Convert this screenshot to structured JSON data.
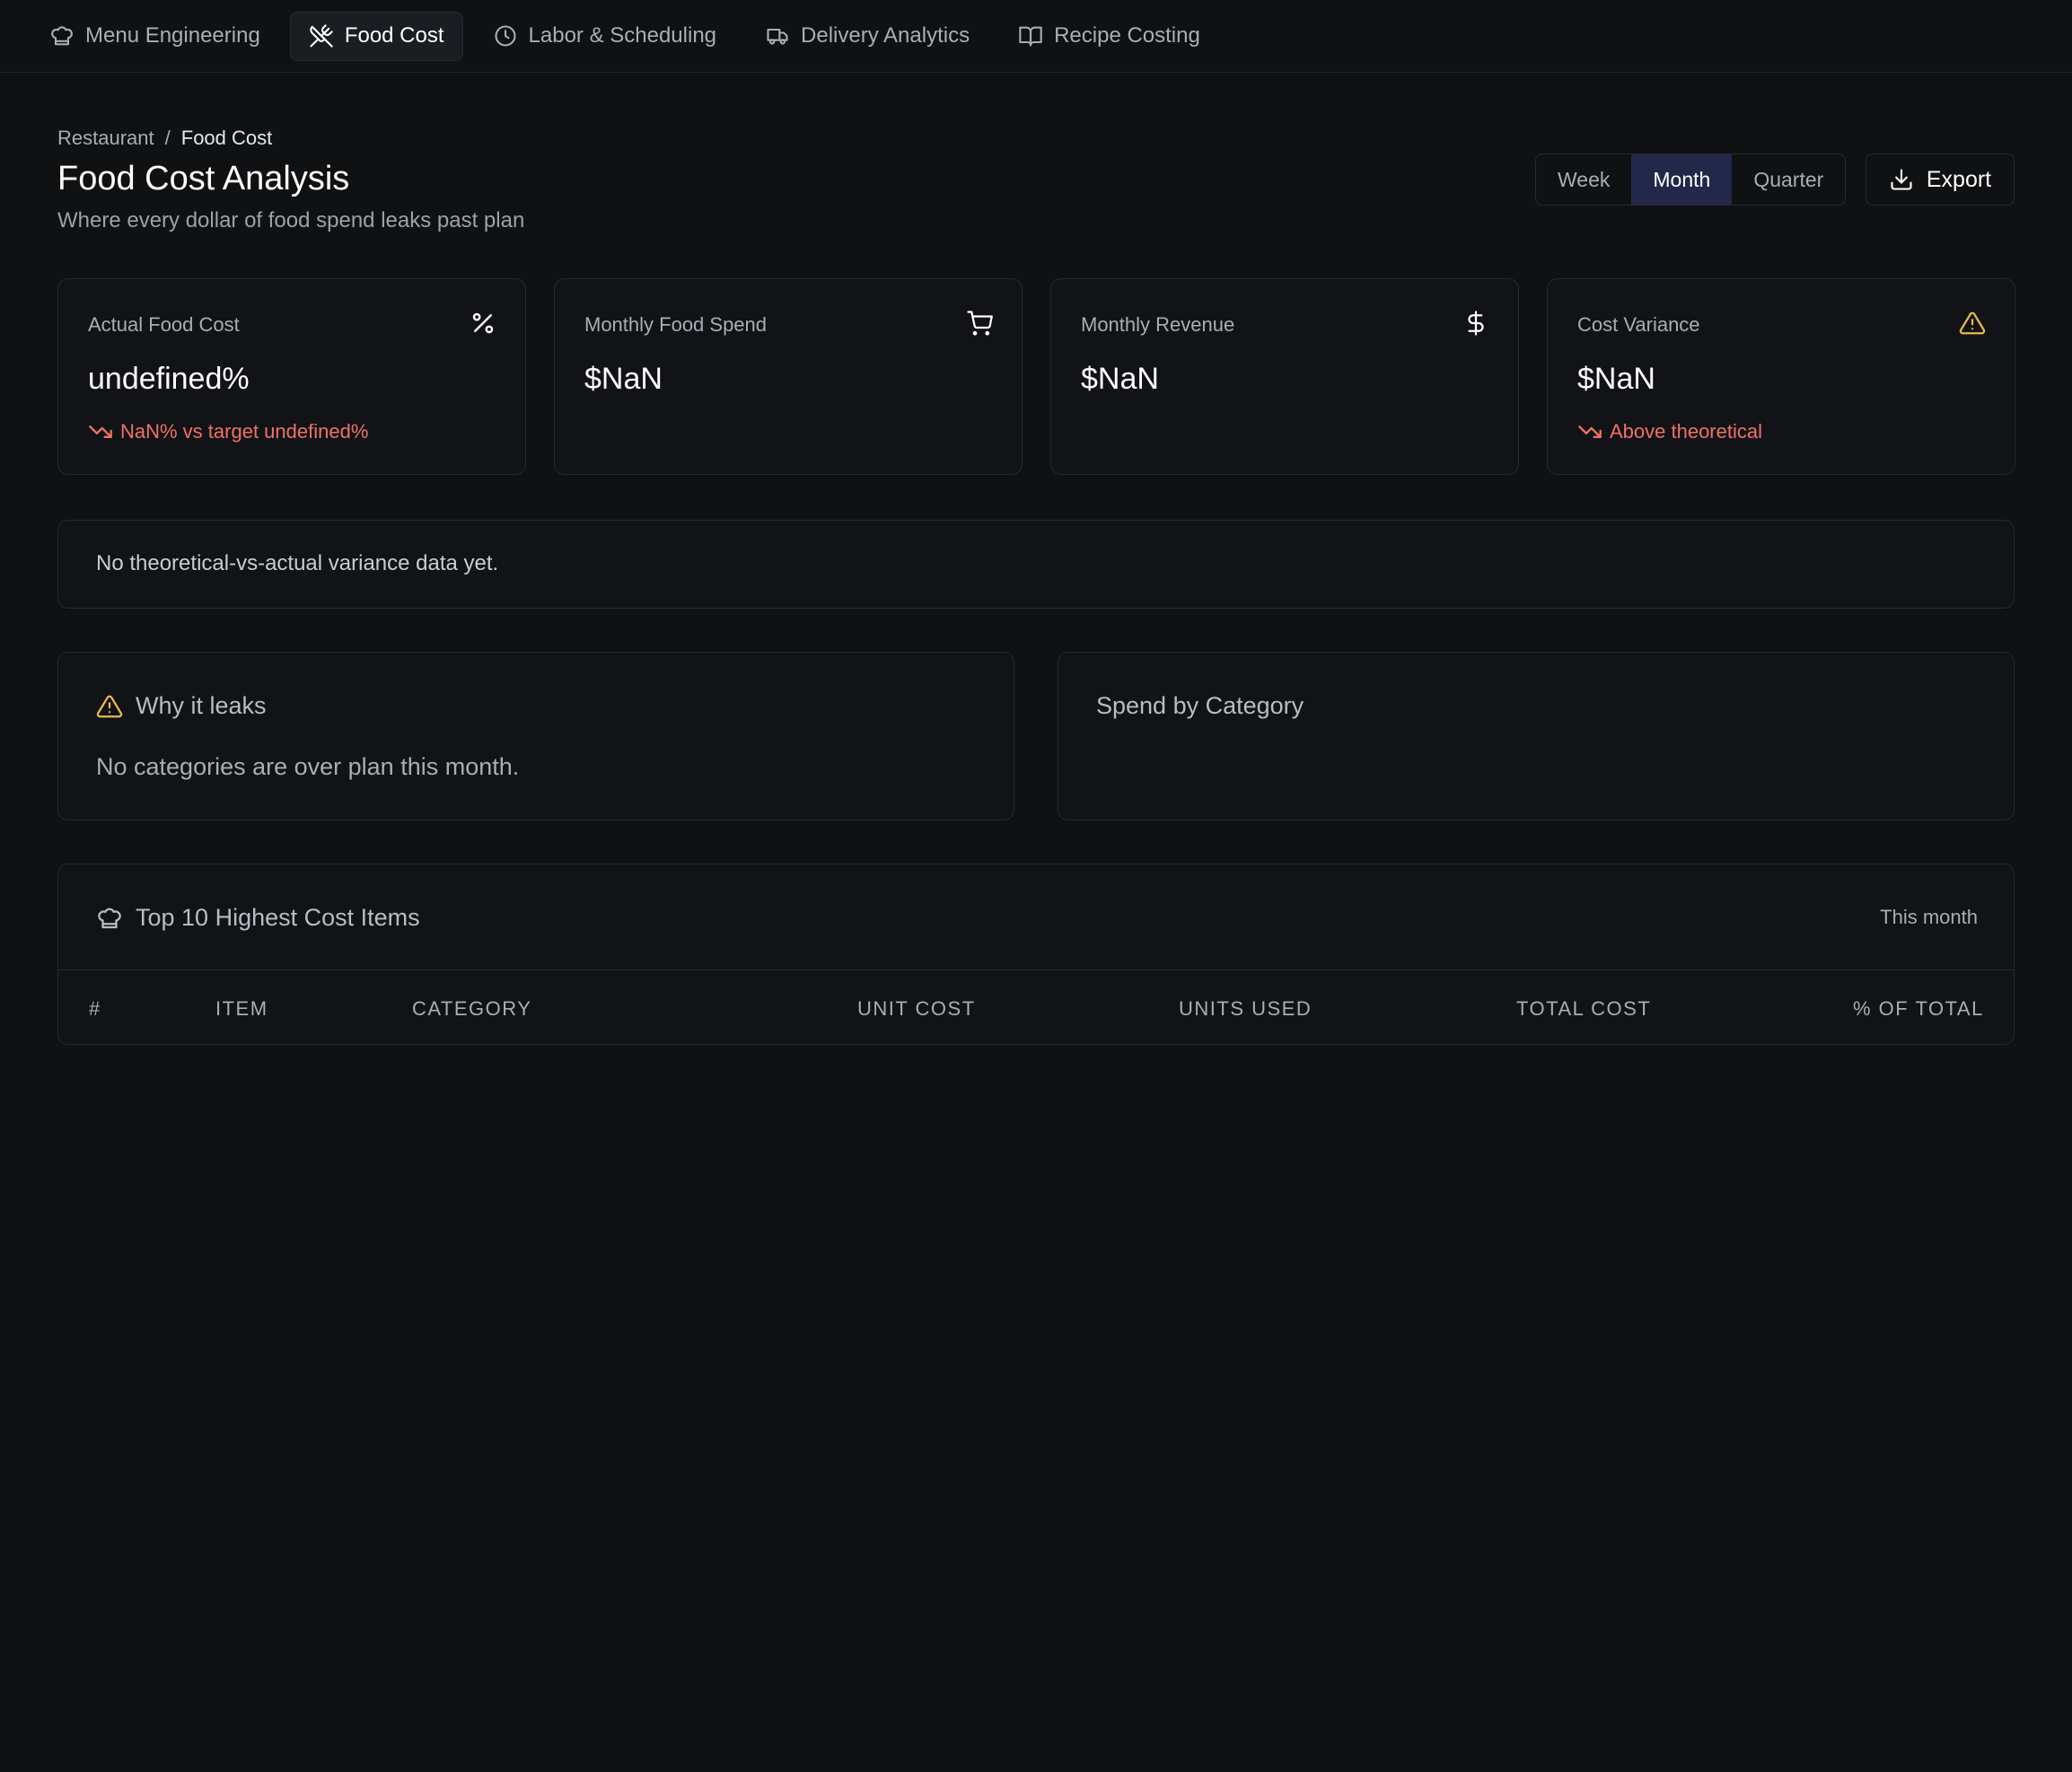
{
  "nav": {
    "items": [
      {
        "label": "Menu Engineering",
        "icon": "chef-hat-icon",
        "active": false
      },
      {
        "label": "Food Cost",
        "icon": "utensils-crossed-icon",
        "active": true
      },
      {
        "label": "Labor & Scheduling",
        "icon": "clock-icon",
        "active": false
      },
      {
        "label": "Delivery Analytics",
        "icon": "truck-icon",
        "active": false
      },
      {
        "label": "Recipe Costing",
        "icon": "book-open-icon",
        "active": false
      }
    ]
  },
  "breadcrumb": {
    "root": "Restaurant",
    "separator": "/",
    "current": "Food Cost"
  },
  "header": {
    "title": "Food Cost Analysis",
    "subtitle": "Where every dollar of food spend leaks past plan"
  },
  "range": {
    "options": [
      "Week",
      "Month",
      "Quarter"
    ],
    "selected": "Month"
  },
  "export": {
    "label": "Export",
    "icon": "download-icon"
  },
  "kpis": [
    {
      "label": "Actual Food Cost",
      "value": "undefined%",
      "trend": "NaN% vs target undefined%",
      "icon": "percent-icon"
    },
    {
      "label": "Monthly Food Spend",
      "value": "$NaN",
      "trend": "",
      "icon": "shopping-cart-icon"
    },
    {
      "label": "Monthly Revenue",
      "value": "$NaN",
      "trend": "",
      "icon": "dollar-sign-icon"
    },
    {
      "label": "Cost Variance",
      "value": "$NaN",
      "trend": "Above theoretical",
      "icon": "alert-triangle-icon"
    }
  ],
  "variance": {
    "empty_text": "No theoretical-vs-actual variance data yet."
  },
  "leaks": {
    "title": "Why it leaks",
    "empty_text": "No categories are over plan this month."
  },
  "category": {
    "title": "Spend by Category"
  },
  "top_items": {
    "title": "Top 10 Highest Cost Items",
    "period": "This month",
    "columns": [
      "#",
      "Item",
      "Category",
      "Unit Cost",
      "Units Used",
      "Total Cost",
      "% of Total"
    ],
    "rows": []
  },
  "colors": {
    "background": "#0f1113",
    "accent_active": "#23274a",
    "negative": "#f07167",
    "warning": "#e9b949"
  }
}
